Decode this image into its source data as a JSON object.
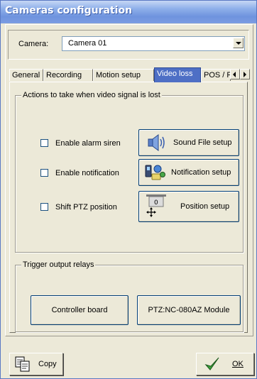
{
  "window": {
    "title": "Cameras configuration"
  },
  "camera": {
    "label": "Camera:",
    "selected": "Camera 01"
  },
  "tabs": [
    {
      "label": "General"
    },
    {
      "label": "Recording"
    },
    {
      "label": "Motion setup"
    },
    {
      "label": "Video loss"
    },
    {
      "label": "POS / Fi"
    }
  ],
  "video_loss": {
    "actions_group": "Actions to take when video signal is lost",
    "actions": [
      {
        "checkbox_label": "Enable alarm siren",
        "checked": false,
        "button_label": "Sound File setup",
        "icon": "speaker-icon"
      },
      {
        "checkbox_label": "Enable notification",
        "checked": false,
        "button_label": "Notification setup",
        "icon": "notification-icon"
      },
      {
        "checkbox_label": "Shift PTZ position",
        "checked": false,
        "button_label": "Position setup",
        "icon": "ptz-position-icon"
      }
    ],
    "relays_group": "Trigger output relays",
    "relays": [
      {
        "label": "Controller board"
      },
      {
        "label": "PTZ:NC-080AZ Module"
      }
    ]
  },
  "footer": {
    "copy_label": "Copy",
    "ok_label": "OK"
  },
  "colors": {
    "active_tab": "#4e6fc5",
    "title_bar": "#7d9de2",
    "dialog_bg": "#ece9d8"
  }
}
